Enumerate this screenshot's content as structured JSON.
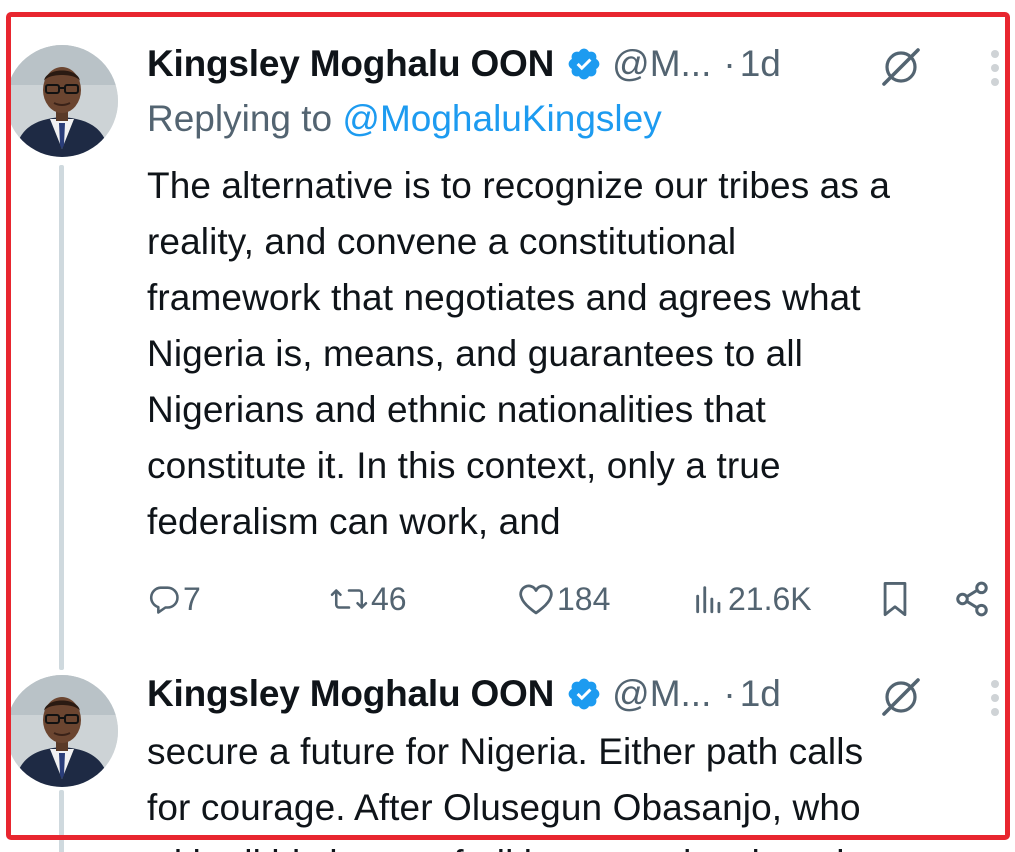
{
  "tweet1": {
    "author_name": "Kingsley Moghalu OON",
    "handle": "@M...",
    "time": "1d",
    "reply_prefix": "Replying to",
    "reply_mention": "@MoghaluKingsley",
    "text_lines": [
      "The alternative is to recognize our tribes as a",
      "reality, and convene a constitutional",
      "framework that negotiates and agrees what",
      "Nigeria is, means, and guarantees to all",
      "Nigerians and ethnic nationalities that",
      "constitute it. In this context, only a true",
      "federalism can work, and"
    ],
    "actions": {
      "replies": "7",
      "reposts": "46",
      "likes": "184",
      "views": "21.6K"
    }
  },
  "tweet2": {
    "author_name": "Kingsley Moghalu OON",
    "handle": "@M...",
    "time": "1d",
    "text_lines": [
      "secure a future for Nigeria. Either path calls",
      "for courage. After Olusegun Obasanjo, who",
      "with all his human frailties, exercise the rule"
    ]
  },
  "icons": {
    "verified": "verified-badge-icon",
    "grok": "grok-icon",
    "more": "more-vertical-icon",
    "reply": "reply-icon",
    "repost": "repost-icon",
    "like": "heart-icon",
    "views": "views-icon",
    "bookmark": "bookmark-icon",
    "share": "share-icon"
  },
  "colors": {
    "highlight_border": "#e8262f",
    "link_blue": "#1d9bf0",
    "muted_gray": "#536471",
    "text_dark": "#0f1419",
    "thread_line": "#cfd9de"
  }
}
